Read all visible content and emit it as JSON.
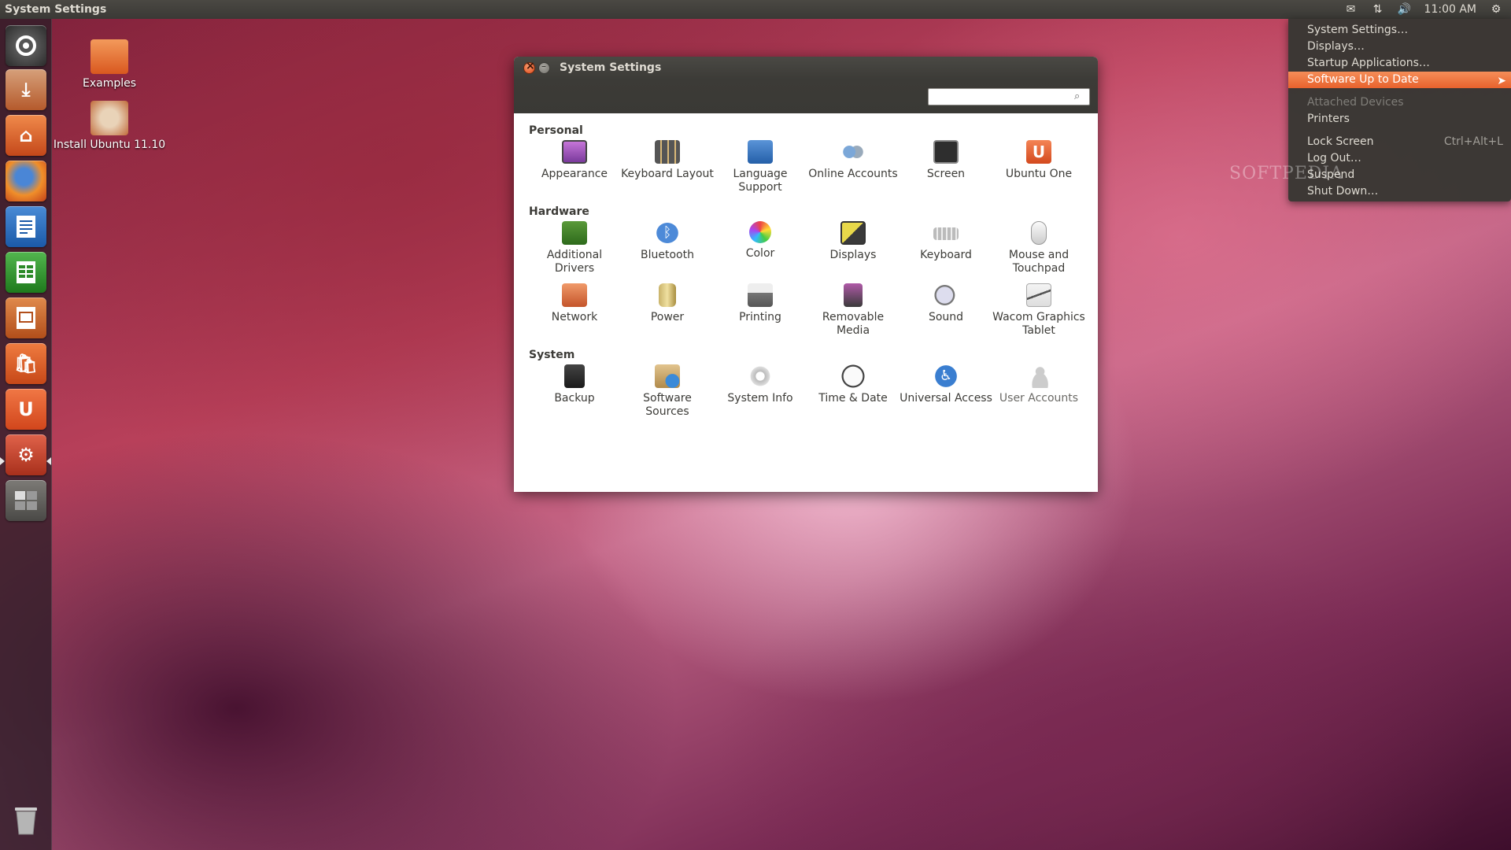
{
  "top_panel": {
    "title": "System Settings",
    "time": "11:00 AM",
    "icons": [
      "mail-icon",
      "network-icon",
      "volume-icon",
      "gear-icon"
    ]
  },
  "launcher": {
    "items": [
      "dash-home-icon",
      "install-ubuntu-icon",
      "home-folder-icon",
      "firefox-icon",
      "writer-icon",
      "calc-icon",
      "impress-icon",
      "software-center-icon",
      "ubuntu-one-icon",
      "system-settings-icon",
      "workspace-switcher-icon",
      "trash-icon"
    ]
  },
  "desktop": {
    "icons": [
      {
        "label": "Examples"
      },
      {
        "label": "Install Ubuntu 11.10"
      }
    ]
  },
  "window": {
    "title": "System Settings",
    "search": {
      "value": "",
      "placeholder": ""
    },
    "sections": [
      {
        "title": "Personal",
        "items": [
          {
            "label": "Appearance",
            "icon": "appearance-icon"
          },
          {
            "label": "Keyboard Layout",
            "icon": "keyboard-layout-icon"
          },
          {
            "label": "Language Support",
            "icon": "language-support-icon"
          },
          {
            "label": "Online Accounts",
            "icon": "online-accounts-icon"
          },
          {
            "label": "Screen",
            "icon": "screen-lock-icon"
          },
          {
            "label": "Ubuntu One",
            "icon": "ubuntu-one-icon"
          }
        ]
      },
      {
        "title": "Hardware",
        "items": [
          {
            "label": "Additional Drivers",
            "icon": "additional-drivers-icon"
          },
          {
            "label": "Bluetooth",
            "icon": "bluetooth-icon"
          },
          {
            "label": "Color",
            "icon": "color-icon"
          },
          {
            "label": "Displays",
            "icon": "displays-icon"
          },
          {
            "label": "Keyboard",
            "icon": "keyboard-icon"
          },
          {
            "label": "Mouse and Touchpad",
            "icon": "mouse-icon"
          },
          {
            "label": "Network",
            "icon": "network-icon"
          },
          {
            "label": "Power",
            "icon": "power-icon"
          },
          {
            "label": "Printing",
            "icon": "printer-icon"
          },
          {
            "label": "Removable Media",
            "icon": "removable-media-icon"
          },
          {
            "label": "Sound",
            "icon": "sound-icon"
          },
          {
            "label": "Wacom Graphics Tablet",
            "icon": "wacom-tablet-icon"
          }
        ]
      },
      {
        "title": "System",
        "items": [
          {
            "label": "Backup",
            "icon": "backup-icon"
          },
          {
            "label": "Software Sources",
            "icon": "software-sources-icon"
          },
          {
            "label": "System Info",
            "icon": "system-info-icon"
          },
          {
            "label": "Time & Date",
            "icon": "clock-icon"
          },
          {
            "label": "Universal Access",
            "icon": "universal-access-icon"
          },
          {
            "label": "User Accounts",
            "icon": "user-accounts-icon"
          }
        ]
      }
    ]
  },
  "menu": {
    "items": [
      {
        "label": "System Settings…",
        "state": "normal"
      },
      {
        "label": "Displays…",
        "state": "normal"
      },
      {
        "label": "Startup Applications…",
        "state": "normal"
      },
      {
        "label": "Software Up to Date",
        "state": "selected"
      },
      {
        "sep": true
      },
      {
        "label": "Attached Devices",
        "state": "disabled"
      },
      {
        "label": "Printers",
        "state": "normal"
      },
      {
        "sep": true
      },
      {
        "label": "Lock Screen",
        "state": "normal",
        "accel": "Ctrl+Alt+L"
      },
      {
        "label": "Log Out…",
        "state": "normal"
      },
      {
        "label": "Suspend",
        "state": "normal"
      },
      {
        "label": "Shut Down…",
        "state": "normal"
      }
    ]
  },
  "watermark": "SOFTPEDIA",
  "colors": {
    "accent": "#f07746",
    "panel": "#3c3b37",
    "window_bg": "#ffffff"
  }
}
